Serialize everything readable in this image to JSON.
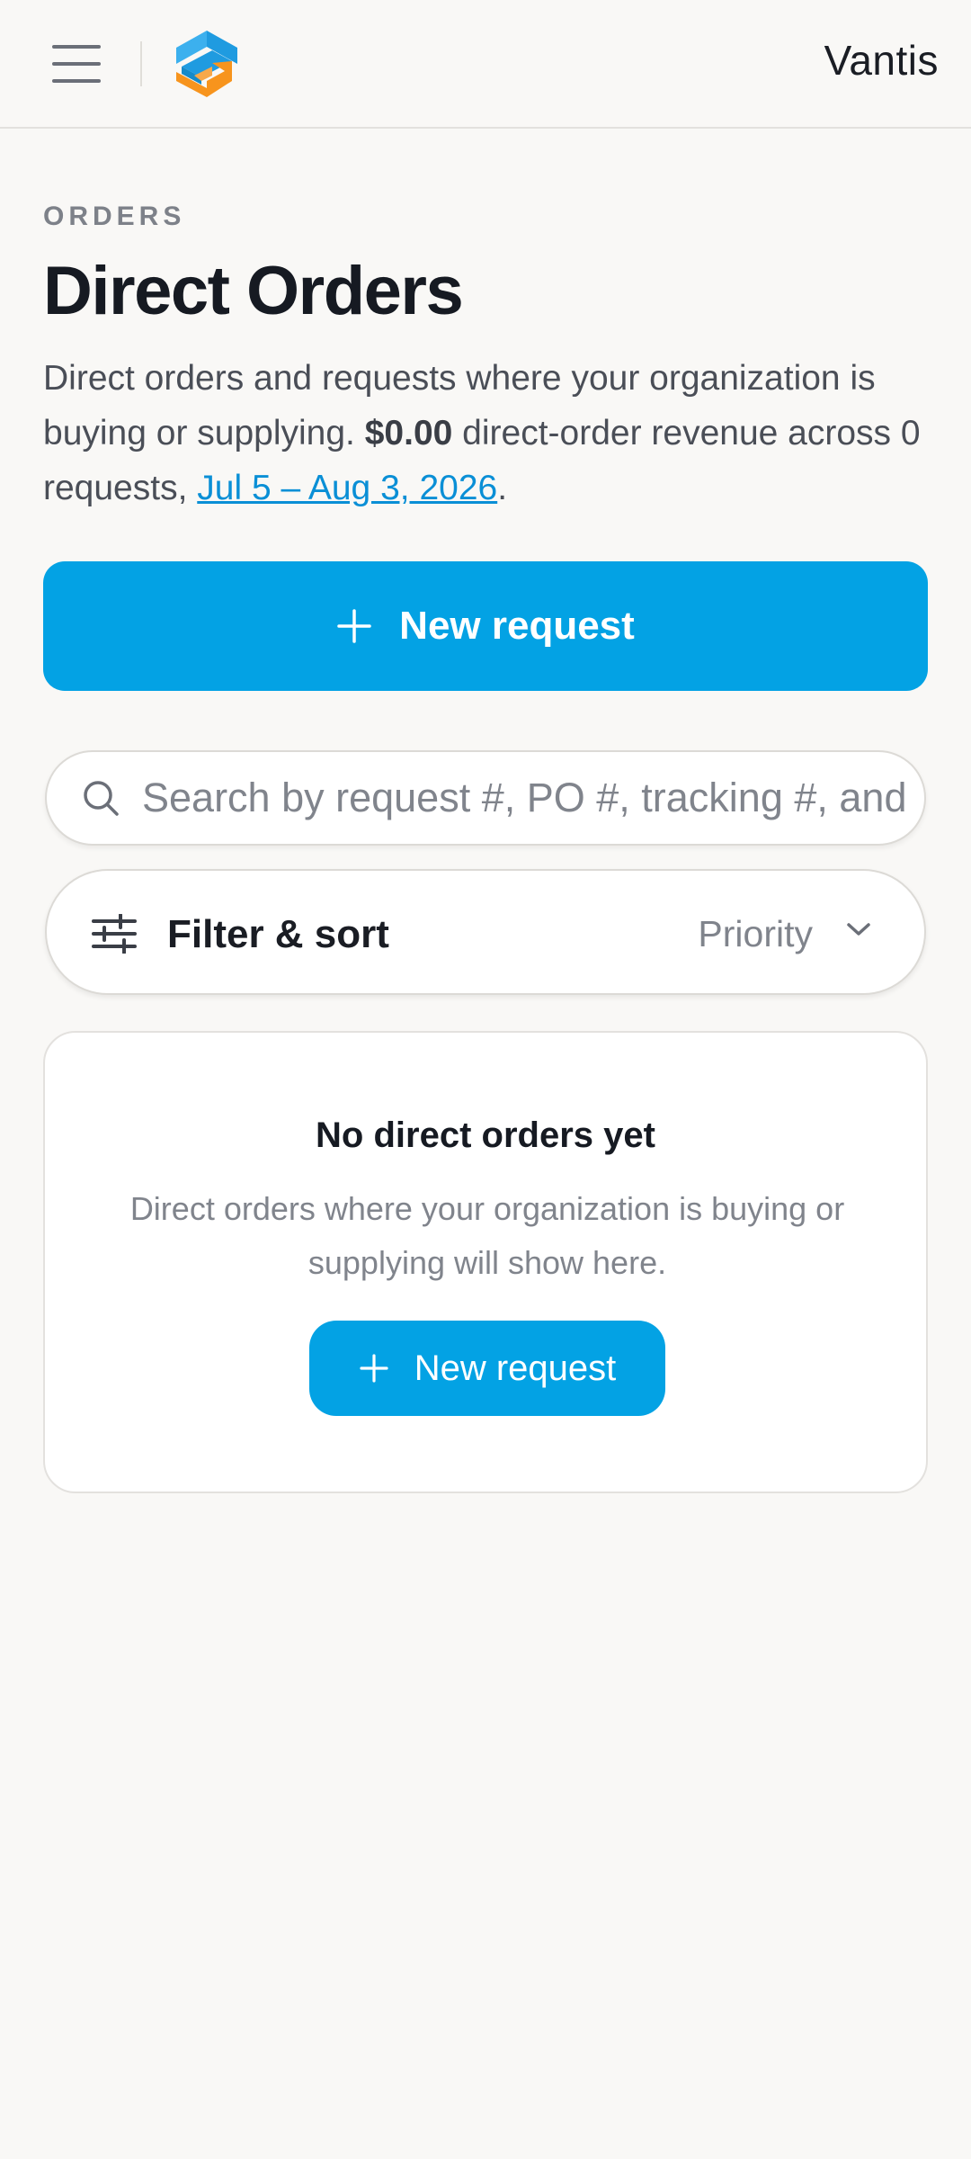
{
  "header": {
    "menu_icon": "hamburger-menu-icon",
    "logo_icon": "brand-logo-icon",
    "brand_name": "Vantis"
  },
  "page": {
    "eyebrow": "ORDERS",
    "title": "Direct Orders",
    "intro_text_1": "Direct orders and requests where your organization is buying or supplying. ",
    "revenue_amount": "$0.00",
    "intro_text_2": " direct-order revenue across 0 requests, ",
    "date_range_link": "Jul 5 – Aug 3, 2026",
    "intro_text_end": "."
  },
  "actions": {
    "new_request_label": "New request",
    "plus_icon": "plus-icon"
  },
  "search": {
    "placeholder": "Search by request #, PO #, tracking #, and more",
    "value": "",
    "icon": "search-icon"
  },
  "filter": {
    "label": "Filter & sort",
    "sort_value": "Priority",
    "icon": "sliders-icon",
    "chevron": "chevron-down-icon"
  },
  "empty_state": {
    "title": "No direct orders yet",
    "description": "Direct orders where your organization is buying or supplying will show here.",
    "button_label": "New request"
  },
  "colors": {
    "accent": "#03a2e4",
    "link": "#0a8fd6",
    "background": "#f9f8f6",
    "logo_blue": "#1f9be0",
    "logo_orange": "#f7941d"
  }
}
